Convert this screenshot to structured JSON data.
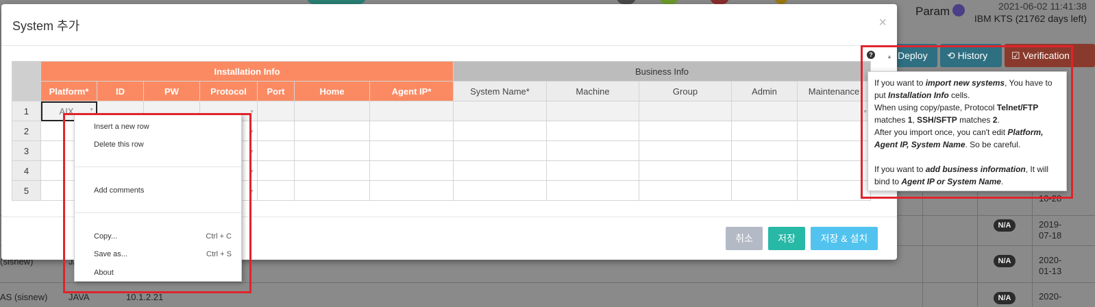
{
  "background": {
    "timestamp": "2021-06-02 11:41:38",
    "license": "IBM KTS (21762 days left)",
    "param_label": "Param",
    "buttons": {
      "deploy": "Deploy",
      "history": "History",
      "verification": "Verification"
    },
    "rows": [
      {
        "name": "(sisnew)",
        "lang": "JA",
        "date": "2019-07-18",
        "status": "N/A"
      },
      {
        "name": "AS (sisnew)",
        "lang": "JAVA",
        "ip": "10.1.2.21",
        "date": "2020-01-13",
        "status": "N/A"
      }
    ],
    "dates": [
      "10-28",
      "2019-",
      "07-18",
      "2020-",
      "01-13",
      "2020-"
    ]
  },
  "modal": {
    "title": "System 추가",
    "close": "×",
    "group_headers": {
      "install": "Installation Info",
      "business": "Business Info"
    },
    "columns_install": [
      "Platform*",
      "ID",
      "PW",
      "Protocol",
      "Port",
      "Home",
      "Agent IP*"
    ],
    "columns_business": [
      "System Name*",
      "Machine",
      "Group",
      "Admin",
      "Maintenance"
    ],
    "rows": [
      "1",
      "2",
      "3",
      "4",
      "5"
    ],
    "first_cell_value": "AIX",
    "buttons": {
      "cancel": "취소",
      "save": "저장",
      "save_install": "저장 & 설치"
    }
  },
  "context_menu": {
    "insert_row": "Insert a new row",
    "delete_row": "Delete this row",
    "add_comments": "Add comments",
    "copy": "Copy...",
    "copy_shortcut": "Ctrl + C",
    "save_as": "Save as...",
    "save_as_shortcut": "Ctrl + S",
    "about": "About"
  },
  "help": {
    "icon": "?",
    "p1_a": "If you want to ",
    "p1_b": "import new systems",
    "p1_c": ", You have to put ",
    "p1_d": "Installation Info",
    "p1_e": " cells.",
    "p2_a": "When using copy/paste, Protocol ",
    "p2_b": "Telnet/FTP",
    "p2_c": " matches ",
    "p2_d": "1",
    "p2_e": ", ",
    "p2_f": "SSH/SFTP",
    "p2_g": " matches ",
    "p2_h": "2",
    "p2_i": ".",
    "p3_a": "After you import once, you can't edit ",
    "p3_b": "Platform, Agent IP, System Name",
    "p3_c": ". So be careful.",
    "p4_a": "If you want to ",
    "p4_b": "add business information",
    "p4_c": ", It will bind to ",
    "p4_d": "Agent IP or System Name",
    "p4_e": "."
  },
  "colors": {
    "install_header": "#fb8a63",
    "save_button": "#27b8a6",
    "install_button": "#52c3ef",
    "highlight": "#e0232b"
  }
}
